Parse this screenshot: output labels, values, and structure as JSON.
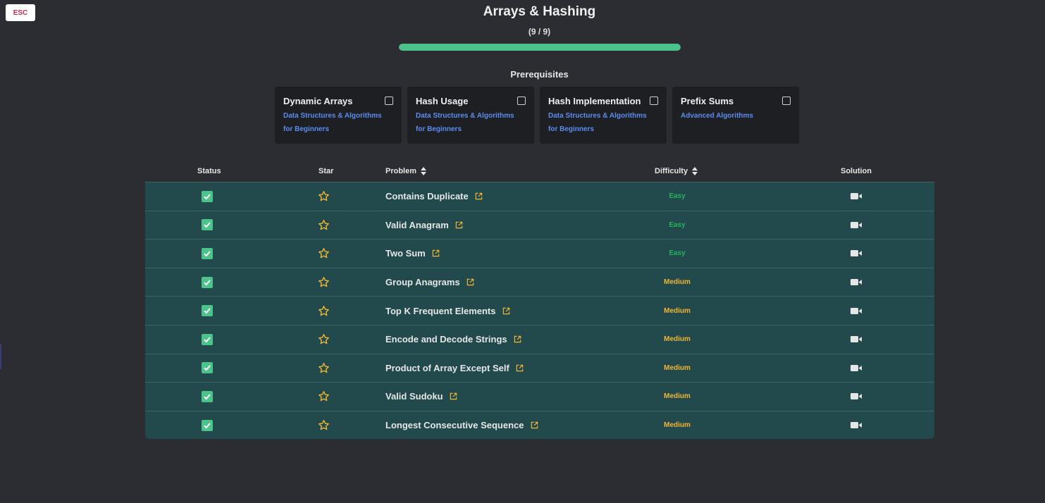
{
  "esc_label": "ESC",
  "title": "Arrays & Hashing",
  "progress": {
    "text": "(9 / 9)",
    "completed": 9,
    "total": 9
  },
  "prerequisites": {
    "heading": "Prerequisites",
    "items": [
      {
        "name": "Dynamic Arrays",
        "course": "Data Structures & Algorithms for Beginners"
      },
      {
        "name": "Hash Usage",
        "course": "Data Structures & Algorithms for Beginners"
      },
      {
        "name": "Hash Implementation",
        "course": "Data Structures & Algorithms for Beginners"
      },
      {
        "name": "Prefix Sums",
        "course": "Advanced Algorithms"
      }
    ]
  },
  "table": {
    "headers": {
      "status": "Status",
      "star": "Star",
      "problem": "Problem",
      "difficulty": "Difficulty",
      "solution": "Solution"
    },
    "rows": [
      {
        "problem": "Contains Duplicate",
        "difficulty": "Easy"
      },
      {
        "problem": "Valid Anagram",
        "difficulty": "Easy"
      },
      {
        "problem": "Two Sum",
        "difficulty": "Easy"
      },
      {
        "problem": "Group Anagrams",
        "difficulty": "Medium"
      },
      {
        "problem": "Top K Frequent Elements",
        "difficulty": "Medium"
      },
      {
        "problem": "Encode and Decode Strings",
        "difficulty": "Medium"
      },
      {
        "problem": "Product of Array Except Self",
        "difficulty": "Medium"
      },
      {
        "problem": "Valid Sudoku",
        "difficulty": "Medium"
      },
      {
        "problem": "Longest Consecutive Sequence",
        "difficulty": "Medium"
      }
    ]
  },
  "colors": {
    "background": "#2c2d32",
    "row_background": "#224a4c",
    "progress": "#4cc38a",
    "easy": "#26b35b",
    "medium": "#f2b634",
    "link": "#5b8def",
    "star": "#f2b634"
  },
  "icons": {
    "status": "checkbox-checked-icon",
    "star": "star-outline-icon",
    "external": "external-link-icon",
    "solution": "video-camera-icon",
    "sort": "sort-icon"
  }
}
